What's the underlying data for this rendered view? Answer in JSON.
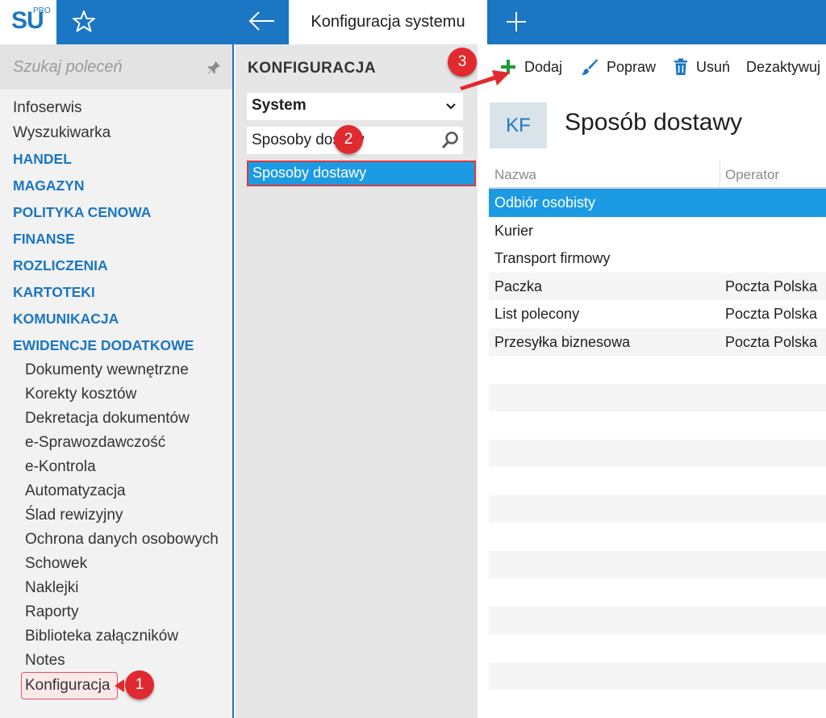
{
  "app": {
    "logo_text": "SU",
    "logo_superscript": "PRO",
    "active_tab": "Konfiguracja systemu"
  },
  "sidebar": {
    "search_placeholder": "Szukaj poleceń",
    "top_items": [
      "Infoserwis",
      "Wyszukiwarka"
    ],
    "sections": [
      "HANDEL",
      "MAGAZYN",
      "POLITYKA CENOWA",
      "FINANSE",
      "ROZLICZENIA",
      "KARTOTEKI",
      "KOMUNIKACJA",
      "EWIDENCJE DODATKOWE"
    ],
    "sub_items": [
      "Dokumenty wewnętrzne",
      "Korekty kosztów",
      "Dekretacja dokumentów",
      "e-Sprawozdawczość",
      "e-Kontrola",
      "Automatyzacja",
      "Ślad rewizyjny",
      "Ochrona danych osobowych",
      "Schowek",
      "Naklejki",
      "Raporty",
      "Biblioteka załączników",
      "Notes",
      "Konfiguracja"
    ]
  },
  "config_panel": {
    "heading": "KONFIGURACJA",
    "category": "System",
    "filter_value": "Sposoby dostaw",
    "tree_selected": "Sposoby dostawy"
  },
  "toolbar": {
    "add_label": "Dodaj",
    "edit_label": "Popraw",
    "delete_label": "Usuń",
    "deactivate_label": "Dezaktywuj"
  },
  "header": {
    "badge": "KF",
    "title": "Sposób dostawy"
  },
  "grid": {
    "columns": [
      "Nazwa",
      "Operator"
    ],
    "rows": [
      {
        "name": "Odbiór osobisty",
        "operator": ""
      },
      {
        "name": "Kurier",
        "operator": ""
      },
      {
        "name": "Transport firmowy",
        "operator": ""
      },
      {
        "name": "Paczka",
        "operator": "Poczta Polska"
      },
      {
        "name": "List polecony",
        "operator": "Poczta Polska"
      },
      {
        "name": "Przesyłka biznesowa",
        "operator": "Poczta Polska"
      }
    ]
  },
  "markers": [
    "1",
    "2",
    "3"
  ],
  "colors": {
    "accent": "#1b76c4",
    "selection": "#1c9be3",
    "marker": "#e02a2f",
    "add_icon": "#1e9c3a"
  }
}
